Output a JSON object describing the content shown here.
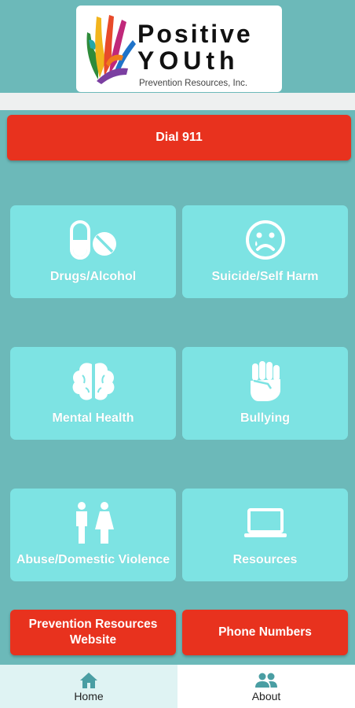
{
  "colors": {
    "background": "#6cb9b9",
    "tile": "#7de3e3",
    "alert_red": "#e8321e",
    "nav_icon": "#4a9ea3"
  },
  "logo": {
    "line1": "Positive",
    "line2": "YOUth",
    "line3": "Prevention Resources, Inc."
  },
  "dial_button": {
    "label": "Dial 911"
  },
  "tiles": [
    {
      "label": "Drugs/Alcohol",
      "icon": "pills-icon"
    },
    {
      "label": "Suicide/Self Harm",
      "icon": "sad-face-icon"
    },
    {
      "label": "Mental Health",
      "icon": "brain-icon"
    },
    {
      "label": "Bullying",
      "icon": "fist-icon"
    },
    {
      "label": "Abuse/Domestic Violence",
      "icon": "restroom-icon"
    },
    {
      "label": "Resources",
      "icon": "laptop-icon"
    }
  ],
  "bottom_buttons": {
    "website_line1": "Prevention Resources",
    "website_line2": "Website",
    "phone": "Phone Numbers"
  },
  "nav": {
    "items": [
      {
        "label": "Home",
        "icon": "home-icon",
        "active": true
      },
      {
        "label": "About",
        "icon": "people-icon",
        "active": false
      }
    ]
  }
}
